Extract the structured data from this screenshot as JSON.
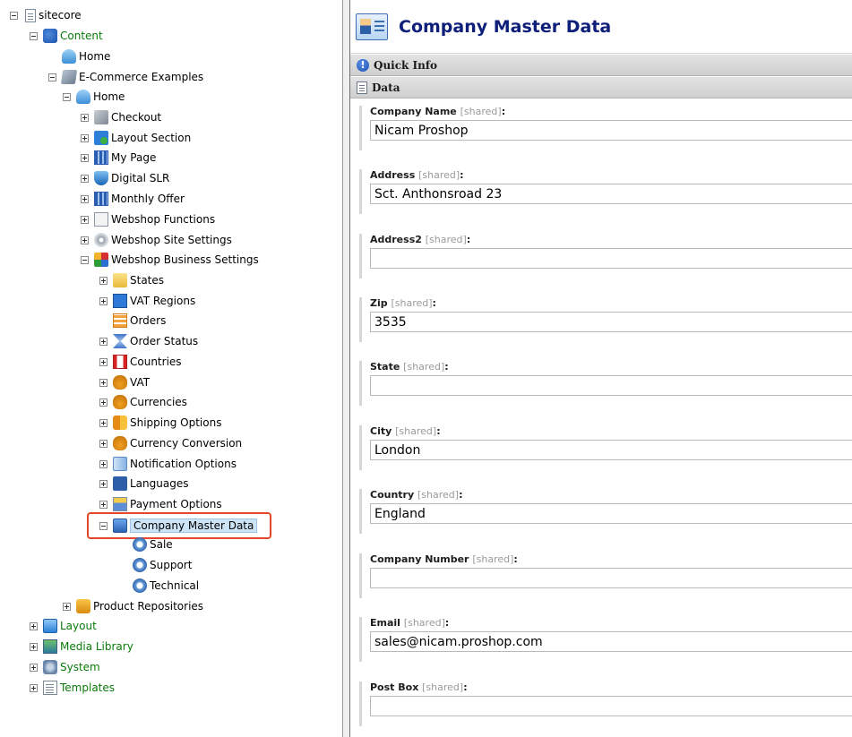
{
  "tree": {
    "root": "sitecore",
    "content": "Content",
    "home_top": "Home",
    "ecommerce": "E-Commerce Examples",
    "home": "Home",
    "items": {
      "checkout": "Checkout",
      "layout_section": "Layout Section",
      "my_page": "My Page",
      "digital_slr": "Digital SLR",
      "monthly_offer": "Monthly Offer",
      "webshop_functions": "Webshop Functions",
      "webshop_site_settings": "Webshop Site Settings",
      "webshop_business_settings": "Webshop Business Settings"
    },
    "business": {
      "states": "States",
      "vat_regions": "VAT Regions",
      "orders": "Orders",
      "order_status": "Order Status",
      "countries": "Countries",
      "vat": "VAT",
      "currencies": "Currencies",
      "shipping_options": "Shipping Options",
      "currency_conversion": "Currency Conversion",
      "notification_options": "Notification Options",
      "languages": "Languages",
      "payment_options": "Payment Options",
      "company_master_data": "Company Master Data"
    },
    "company_children": {
      "sale": "Sale",
      "support": "Support",
      "technical": "Technical"
    },
    "product_repositories": "Product Repositories",
    "layout": "Layout",
    "media_library": "Media Library",
    "system": "System",
    "templates": "Templates"
  },
  "editor": {
    "title": "Company Master Data",
    "quick_info": "Quick Info",
    "data_section": "Data",
    "shared_tag": "[shared]",
    "fields": {
      "company_name": {
        "label": "Company Name",
        "value": "Nicam Proshop"
      },
      "address": {
        "label": "Address",
        "value": "Sct. Anthonsroad 23"
      },
      "address2": {
        "label": "Address2",
        "value": ""
      },
      "zip": {
        "label": "Zip",
        "value": "3535"
      },
      "state": {
        "label": "State",
        "value": ""
      },
      "city": {
        "label": "City",
        "value": "London"
      },
      "country": {
        "label": "Country",
        "value": "England"
      },
      "company_number": {
        "label": "Company Number",
        "value": ""
      },
      "email": {
        "label": "Email",
        "value": "sales@nicam.proshop.com"
      },
      "post_box": {
        "label": "Post Box",
        "value": ""
      }
    }
  },
  "colors": {
    "title": "#0e1f7a",
    "tree_green": "#0a7a0a",
    "highlight_border": "#e8462a"
  },
  "icons": {
    "root": "document-icon",
    "content": "content-icon",
    "home": "home-icon",
    "company_master_data": "company-card-icon",
    "sale": "at-sign-icon"
  }
}
